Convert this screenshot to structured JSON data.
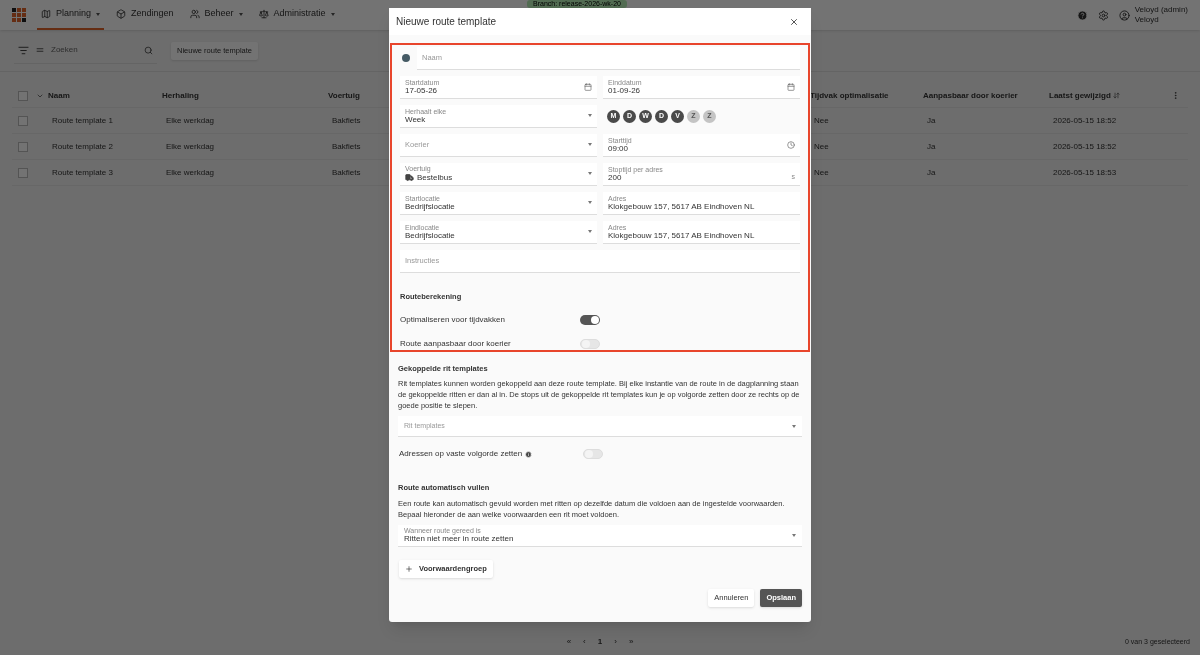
{
  "nav": {
    "items": [
      {
        "label": "Planning",
        "selected": true,
        "caret": true
      },
      {
        "label": "Zendingen",
        "selected": false,
        "caret": false
      },
      {
        "label": "Beheer",
        "selected": false,
        "caret": true
      },
      {
        "label": "Administratie",
        "selected": false,
        "caret": true
      }
    ],
    "branch_badge": "Branch: release-2026-wk-20",
    "user": {
      "name": "Veloyd (admin)",
      "org": "Veloyd"
    }
  },
  "toolbar": {
    "search_placeholder": "Zoeken",
    "new_button": "Nieuwe route template"
  },
  "table": {
    "all_selected": false,
    "columns": [
      {
        "label": "Naam"
      },
      {
        "label": "Herhaling"
      },
      {
        "label": "Voertuig"
      },
      {
        "label": "Tijdvak optimalisatie"
      },
      {
        "label": "Aanpasbaar door koerier"
      },
      {
        "label": "Laatst gewijzigd"
      }
    ],
    "rows": [
      {
        "selected": false,
        "cells": [
          "Route template 1",
          "Elke werkdag",
          "Bakfiets",
          "Nee",
          "Ja",
          "2026-05-15 18:52"
        ]
      },
      {
        "selected": false,
        "cells": [
          "Route template 2",
          "Elke werkdag",
          "Bakfiets",
          "Nee",
          "Ja",
          "2026-05-15 18:52"
        ]
      },
      {
        "selected": false,
        "cells": [
          "Route template 3",
          "Elke werkdag",
          "Bakfiets",
          "Nee",
          "Ja",
          "2026-05-15 18:53"
        ]
      }
    ]
  },
  "pagination": {
    "first": "«",
    "prev": "‹",
    "page": "1",
    "next": "›",
    "last": "»",
    "selection": "0 van 3 geselecteerd"
  },
  "modal": {
    "title": "Nieuwe route template",
    "name": {
      "placeholder": "Naam",
      "color": "#455a64"
    },
    "rows": [
      [
        {
          "kind": "date",
          "label": "Startdatum",
          "value": "17-05-26"
        },
        {
          "kind": "date",
          "label": "Einddatum",
          "value": "01-09-26"
        }
      ],
      [
        {
          "kind": "select",
          "label": "Herhaalt elke",
          "value": "Week"
        },
        {
          "kind": "days",
          "days": [
            {
              "label": "M",
              "selected": true
            },
            {
              "label": "D",
              "selected": true
            },
            {
              "label": "W",
              "selected": true
            },
            {
              "label": "D",
              "selected": true
            },
            {
              "label": "V",
              "selected": true
            },
            {
              "label": "Z",
              "selected": false
            },
            {
              "label": "Z",
              "selected": false
            }
          ]
        }
      ],
      [
        {
          "kind": "select",
          "placeholder": "Koerier"
        },
        {
          "kind": "time",
          "label": "Starttijd",
          "value": "09:00"
        }
      ],
      [
        {
          "kind": "select",
          "label": "Voertuig",
          "value": "Bestelbus"
        },
        {
          "kind": "number",
          "label": "Stoptijd per adres",
          "value": "200",
          "suffix": "s"
        }
      ],
      [
        {
          "kind": "select",
          "label": "Startlocatie",
          "value": "Bedrijfslocatie"
        },
        {
          "kind": "text",
          "label": "Adres",
          "value": "Klokgebouw 157, 5617 AB Eindhoven NL"
        }
      ],
      [
        {
          "kind": "select",
          "label": "Eindlocatie",
          "value": "Bedrijfslocatie"
        },
        {
          "kind": "text",
          "label": "Adres",
          "value": "Klokgebouw 157, 5617 AB Eindhoven NL"
        }
      ]
    ],
    "instructions_placeholder": "Instructies",
    "routing": {
      "title": "Routeberekening",
      "toggles": [
        {
          "label": "Optimaliseren voor tijdvakken",
          "on": true
        },
        {
          "label": "Route aanpasbaar door koerier",
          "on": false
        }
      ]
    },
    "linked": {
      "title": "Gekoppelde rit templates",
      "description": "Rit templates kunnen worden gekoppeld aan deze route template. Bij elke instantie van de route in de dagplanning staan de gekoppelde ritten er dan al in. De stops uit de gekoppelde rit templates kun je op volgorde zetten door ze rechts op de goede positie te slepen.",
      "select_placeholder": "Rit templates",
      "toggle": {
        "label": "Adressen op vaste volgorde zetten",
        "on": false
      }
    },
    "autofill": {
      "title": "Route automatisch vullen",
      "description": "Een route kan automatisch gevuld worden met ritten op dezelfde datum die voldoen aan de ingestelde voorwaarden. Bepaal hieronder de aan welke voorwaarden een rit moet voldoen.",
      "select": {
        "label": "Wanneer route gereed is",
        "value": "Ritten niet meer in route zetten"
      },
      "add_button": "Voorwaardengroep"
    },
    "cancel": "Annuleren",
    "save": "Opslaan"
  }
}
